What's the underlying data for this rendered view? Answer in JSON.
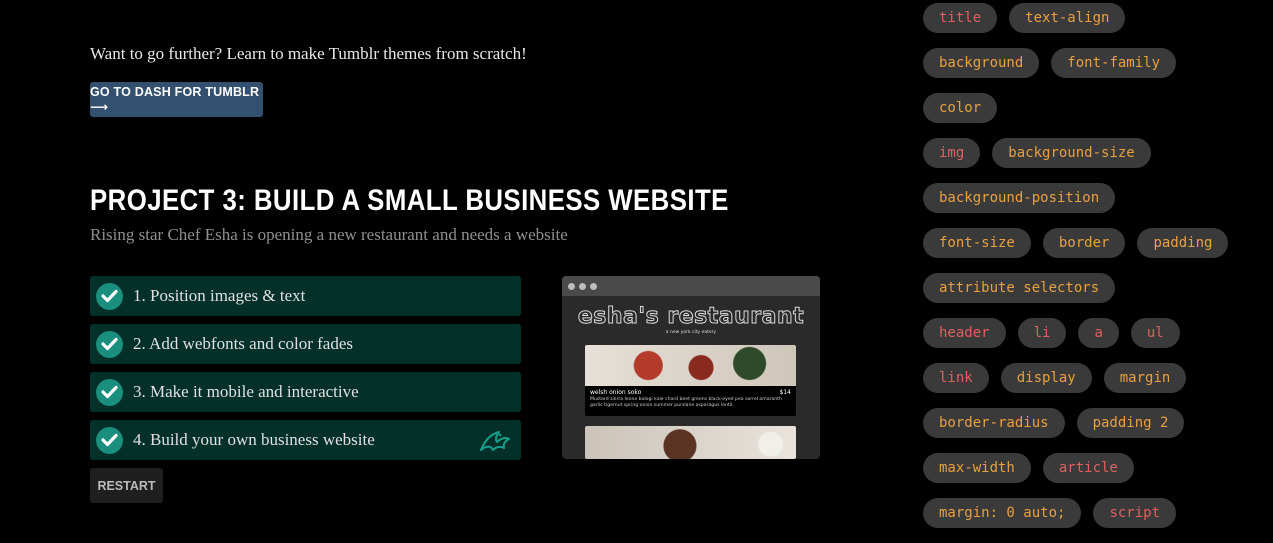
{
  "intro": {
    "text": "Want to go further? Learn to make Tumblr themes from scratch!",
    "button_label": "GO TO DASH FOR TUMBLR ⟶"
  },
  "project": {
    "title": "PROJECT 3: BUILD A SMALL BUSINESS WEBSITE",
    "subtitle": "Rising star Chef Esha is opening a new restaurant and needs a website",
    "steps": [
      {
        "label": "1. Position images & text",
        "done": true
      },
      {
        "label": "2. Add webfonts and color fades",
        "done": true
      },
      {
        "label": "3. Make it mobile and interactive",
        "done": true
      },
      {
        "label": "4. Build your own business website",
        "done": true
      }
    ],
    "restart_label": "RESTART"
  },
  "preview": {
    "site_title": "esha's restaurant",
    "tagline": "a new york city eatery",
    "dish_name": "welsh onion soko",
    "dish_price": "$14",
    "dish_desc": "Mustard sierra leone bologi kale chard beet greens black-eyed pea sorrel amaranth garlic tigernut spring onion summer purslane asparagus lentil."
  },
  "tags": [
    [
      {
        "text": "title",
        "color": "#e06060"
      },
      {
        "text": "text-align",
        "color": "#e8a040"
      }
    ],
    [
      {
        "text": "background",
        "color": "#e8a040"
      },
      {
        "text": "font-family",
        "color": "#e8a040"
      }
    ],
    [
      {
        "text": "color",
        "color": "#e8a040"
      }
    ],
    [
      {
        "text": "img",
        "color": "#e06060"
      },
      {
        "text": "background-size",
        "color": "#e8a040"
      }
    ],
    [
      {
        "text": "background-position",
        "color": "#e8a040"
      }
    ],
    [
      {
        "text": "font-size",
        "color": "#e8a040"
      },
      {
        "text": "border",
        "color": "#e8a040"
      },
      {
        "text": "padding",
        "color": "#e8a040"
      }
    ],
    [
      {
        "text": "attribute selectors",
        "color": "#e8a040"
      }
    ],
    [
      {
        "text": "header",
        "color": "#e06060"
      },
      {
        "text": "li",
        "color": "#e06060"
      },
      {
        "text": "a",
        "color": "#e06060"
      },
      {
        "text": "ul",
        "color": "#e06060"
      }
    ],
    [
      {
        "text": "link",
        "color": "#e06060"
      },
      {
        "text": "display",
        "color": "#e8a040"
      },
      {
        "text": "margin",
        "color": "#e8a040"
      }
    ],
    [
      {
        "text": "border-radius",
        "color": "#e8a040"
      },
      {
        "text": "padding 2",
        "color": "#e8a040"
      }
    ],
    [
      {
        "text": "max-width",
        "color": "#e8a040"
      },
      {
        "text": "article",
        "color": "#e06060"
      }
    ],
    [
      {
        "text": "margin: 0 auto;",
        "color": "#e8a040"
      },
      {
        "text": "script",
        "color": "#e06060"
      }
    ]
  ]
}
